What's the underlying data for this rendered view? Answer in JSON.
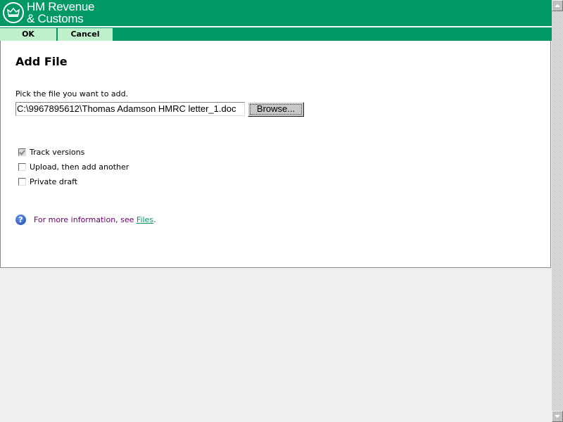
{
  "header": {
    "brand_line1": "HM Revenue",
    "brand_line2": "& Customs"
  },
  "toolbar": {
    "ok_label": "OK",
    "cancel_label": "Cancel"
  },
  "main": {
    "title": "Add File",
    "pick_label": "Pick the file you want to add.",
    "file_value": "C:\\9967895612\\Thomas Adamson HMRC letter_1.doc",
    "browse_label": "Browse...",
    "options": [
      {
        "label": "Track versions",
        "checked": true,
        "disabled": true
      },
      {
        "label": "Upload, then add another",
        "checked": false
      },
      {
        "label": "Private draft",
        "checked": false
      }
    ],
    "info_text": "For more information, see ",
    "info_link": "Files",
    "info_end": "."
  },
  "colors": {
    "brand": "#009966",
    "button": "#bff0cc",
    "info_text": "#660066"
  }
}
